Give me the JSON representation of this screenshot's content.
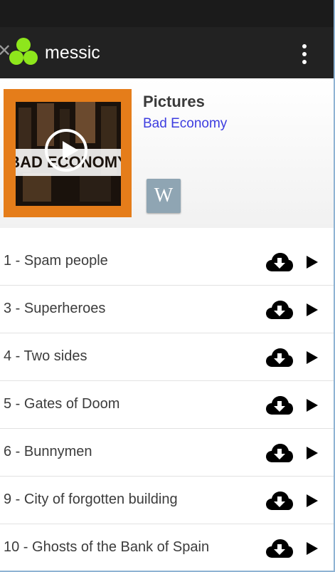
{
  "app": {
    "title": "messic",
    "up_icon": "close-icon",
    "logo_icon": "messic-logo-icon",
    "menu_icon": "overflow-menu-icon"
  },
  "album": {
    "title": "Pictures",
    "artist": "Bad Economy",
    "cover_text": "BAD ECONOMY",
    "wiki_label": "W"
  },
  "tracks": [
    {
      "label": "1 - Spam people"
    },
    {
      "label": "3 - Superheroes"
    },
    {
      "label": "4 - Two sides"
    },
    {
      "label": "5 - Gates of Doom"
    },
    {
      "label": "6 - Bunnymen"
    },
    {
      "label": "9 - City of forgotten building"
    },
    {
      "label": "10 - Ghosts of the Bank of Spain"
    }
  ],
  "colors": {
    "actionbar": "#222222",
    "cover_bg": "#e57d1a",
    "artist_link": "#3d3de0",
    "logo": "#8ee61c",
    "wiki_button": "#8fa5b3"
  }
}
